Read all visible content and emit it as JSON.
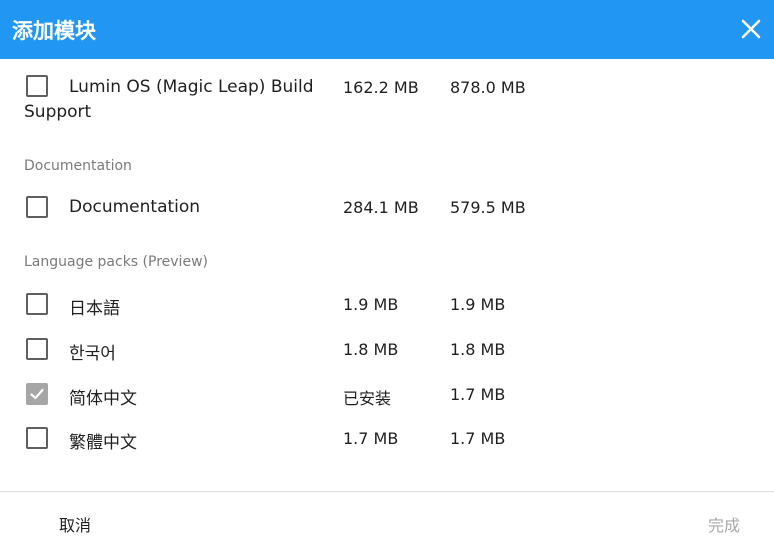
{
  "dialog": {
    "title": "添加模块",
    "close_icon": "close-icon",
    "accent_color": "#2196f3"
  },
  "modules": [
    {
      "name_line1": "Lumin OS (Magic Leap) Build",
      "name_line2": "Support",
      "download": "162.2 MB",
      "install": "878.0 MB",
      "checked": false
    }
  ],
  "sections": {
    "documentation": {
      "title": "Documentation",
      "items": [
        {
          "name": "Documentation",
          "download": "284.1 MB",
          "install": "579.5 MB",
          "checked": false
        }
      ]
    },
    "language_packs": {
      "title": "Language packs (Preview)",
      "items": [
        {
          "name": "日本語",
          "download": "1.9 MB",
          "install": "1.9 MB",
          "checked": false
        },
        {
          "name": "한국어",
          "download": "1.8 MB",
          "install": "1.8 MB",
          "checked": false
        },
        {
          "name": "简体中文",
          "download": "已安装",
          "install": "1.7 MB",
          "checked": true
        },
        {
          "name": "繁體中文",
          "download": "1.7 MB",
          "install": "1.7 MB",
          "checked": false
        }
      ]
    }
  },
  "footer": {
    "cancel_label": "取消",
    "done_label": "完成"
  }
}
